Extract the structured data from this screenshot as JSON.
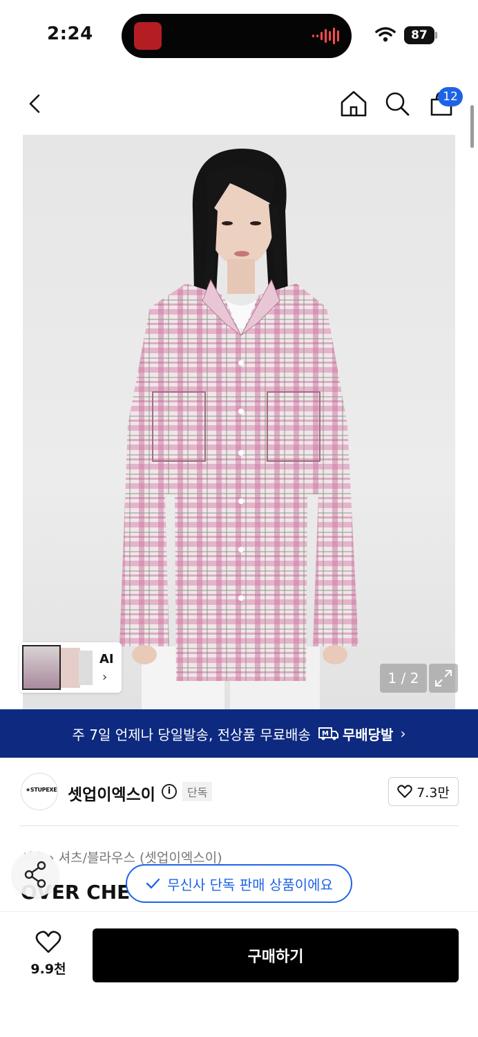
{
  "status_bar": {
    "time": "2:24",
    "battery": "87"
  },
  "nav": {
    "cart_count": "12"
  },
  "gallery": {
    "pager": "1 / 2",
    "ai_label": "AI"
  },
  "banner": {
    "text": "주 7일 언제나 당일발송, 전상품 무료배송",
    "service": "무배당발",
    "service_logo": "M"
  },
  "brand": {
    "logo_text": "★STUPEXE",
    "name": "셋업이엑스이",
    "tag": "단독",
    "likes": "7.3만"
  },
  "category": {
    "first": "셔츠",
    "path": "셔츠/블라우스 (셋업이엑스이)"
  },
  "product": {
    "title_visible": "OVER CHEC"
  },
  "notice": {
    "exclusive": "무신사 단독 판매 상품이에요"
  },
  "bottom": {
    "wish_count": "9.9천",
    "buy_label": "구매하기"
  },
  "colors": {
    "accent_blue": "#1e63e6",
    "banner_navy": "#0d2a80",
    "buy_black": "#000000"
  }
}
